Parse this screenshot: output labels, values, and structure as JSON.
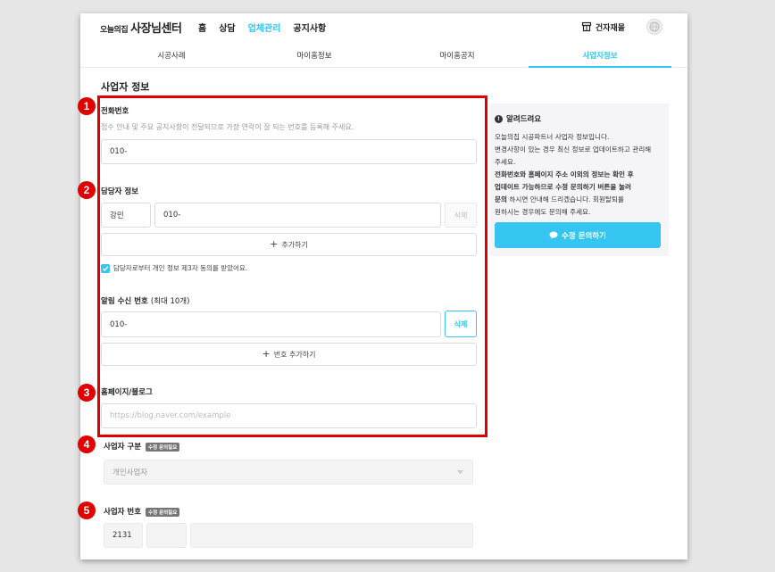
{
  "brand": {
    "small": "오늘의집",
    "title": "사장님센터"
  },
  "nav": [
    {
      "label": "홈",
      "active": false
    },
    {
      "label": "상담",
      "active": false
    },
    {
      "label": "업체관리",
      "active": true
    },
    {
      "label": "공지사항",
      "active": false
    }
  ],
  "header": {
    "builder_label": "건자재몰"
  },
  "tabs": [
    {
      "label": "시공사례",
      "active": false
    },
    {
      "label": "마이홈정보",
      "active": false
    },
    {
      "label": "마이홈공지",
      "active": false
    },
    {
      "label": "사업자정보",
      "active": true
    }
  ],
  "page": {
    "title": "사업자 정보"
  },
  "form": {
    "phone": {
      "label": "전화번호",
      "help": "접수 안내 및 주요 공지사항이 전달되므로 가장 연락이 잘 되는 번호를 등록해 주세요.",
      "value": "010-"
    },
    "manager": {
      "label": "담당자 정보",
      "name": "강민",
      "phone": "010-",
      "delete_label": "삭제",
      "add_label": "추가하기",
      "consent": "담당자로부터 개인 정보 제3자 동의를 받았어요."
    },
    "alert": {
      "label": "알림 수신 번호",
      "label_sub": "(최대 10개)",
      "value": "010-",
      "delete_label": "삭제",
      "add_label": "번호 추가하기"
    },
    "homepage": {
      "label": "홈페이지/블로그",
      "placeholder": "https://blog.naver.com/example"
    },
    "business_type": {
      "label": "사업자 구분",
      "tag": "수정 문의필요",
      "value": "개인사업자"
    },
    "business_number": {
      "label": "사업자 번호",
      "tag": "수정 문의필요",
      "part1": "2131"
    }
  },
  "notice": {
    "title": "알려드려요",
    "line1": "오늘의집 시공파트너 사업자 정보입니다.",
    "line2": "변경사항이 있는 경우 최신 정보로 업데이트하고 관리해",
    "line3": "주세요.",
    "bold1": "전화번호와 홈페이지 주소 이외의 정보는 확인 후",
    "bold2": "업데이트 가능하므로 수정 문의하기 버튼을 눌러",
    "bold3": "문의",
    "line4": " 하시면 안내해 드리겠습니다. 회원탈퇴를",
    "line5": "원하시는 경우에도 문의해 주세요.",
    "button_label": "수정 문의하기"
  },
  "annotations": [
    "1",
    "2",
    "3",
    "4",
    "5"
  ],
  "colors": {
    "accent": "#35c5f0",
    "annotation": "#e00000"
  }
}
